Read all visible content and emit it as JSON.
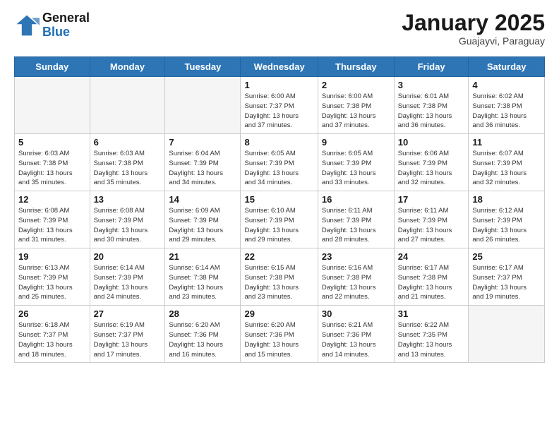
{
  "header": {
    "logo_line1": "General",
    "logo_line2": "Blue",
    "month": "January 2025",
    "location": "Guajayvi, Paraguay"
  },
  "days_of_week": [
    "Sunday",
    "Monday",
    "Tuesday",
    "Wednesday",
    "Thursday",
    "Friday",
    "Saturday"
  ],
  "weeks": [
    [
      {
        "day": "",
        "info": ""
      },
      {
        "day": "",
        "info": ""
      },
      {
        "day": "",
        "info": ""
      },
      {
        "day": "1",
        "info": "Sunrise: 6:00 AM\nSunset: 7:37 PM\nDaylight: 13 hours\nand 37 minutes."
      },
      {
        "day": "2",
        "info": "Sunrise: 6:00 AM\nSunset: 7:38 PM\nDaylight: 13 hours\nand 37 minutes."
      },
      {
        "day": "3",
        "info": "Sunrise: 6:01 AM\nSunset: 7:38 PM\nDaylight: 13 hours\nand 36 minutes."
      },
      {
        "day": "4",
        "info": "Sunrise: 6:02 AM\nSunset: 7:38 PM\nDaylight: 13 hours\nand 36 minutes."
      }
    ],
    [
      {
        "day": "5",
        "info": "Sunrise: 6:03 AM\nSunset: 7:38 PM\nDaylight: 13 hours\nand 35 minutes."
      },
      {
        "day": "6",
        "info": "Sunrise: 6:03 AM\nSunset: 7:38 PM\nDaylight: 13 hours\nand 35 minutes."
      },
      {
        "day": "7",
        "info": "Sunrise: 6:04 AM\nSunset: 7:39 PM\nDaylight: 13 hours\nand 34 minutes."
      },
      {
        "day": "8",
        "info": "Sunrise: 6:05 AM\nSunset: 7:39 PM\nDaylight: 13 hours\nand 34 minutes."
      },
      {
        "day": "9",
        "info": "Sunrise: 6:05 AM\nSunset: 7:39 PM\nDaylight: 13 hours\nand 33 minutes."
      },
      {
        "day": "10",
        "info": "Sunrise: 6:06 AM\nSunset: 7:39 PM\nDaylight: 13 hours\nand 32 minutes."
      },
      {
        "day": "11",
        "info": "Sunrise: 6:07 AM\nSunset: 7:39 PM\nDaylight: 13 hours\nand 32 minutes."
      }
    ],
    [
      {
        "day": "12",
        "info": "Sunrise: 6:08 AM\nSunset: 7:39 PM\nDaylight: 13 hours\nand 31 minutes."
      },
      {
        "day": "13",
        "info": "Sunrise: 6:08 AM\nSunset: 7:39 PM\nDaylight: 13 hours\nand 30 minutes."
      },
      {
        "day": "14",
        "info": "Sunrise: 6:09 AM\nSunset: 7:39 PM\nDaylight: 13 hours\nand 29 minutes."
      },
      {
        "day": "15",
        "info": "Sunrise: 6:10 AM\nSunset: 7:39 PM\nDaylight: 13 hours\nand 29 minutes."
      },
      {
        "day": "16",
        "info": "Sunrise: 6:11 AM\nSunset: 7:39 PM\nDaylight: 13 hours\nand 28 minutes."
      },
      {
        "day": "17",
        "info": "Sunrise: 6:11 AM\nSunset: 7:39 PM\nDaylight: 13 hours\nand 27 minutes."
      },
      {
        "day": "18",
        "info": "Sunrise: 6:12 AM\nSunset: 7:39 PM\nDaylight: 13 hours\nand 26 minutes."
      }
    ],
    [
      {
        "day": "19",
        "info": "Sunrise: 6:13 AM\nSunset: 7:39 PM\nDaylight: 13 hours\nand 25 minutes."
      },
      {
        "day": "20",
        "info": "Sunrise: 6:14 AM\nSunset: 7:39 PM\nDaylight: 13 hours\nand 24 minutes."
      },
      {
        "day": "21",
        "info": "Sunrise: 6:14 AM\nSunset: 7:38 PM\nDaylight: 13 hours\nand 23 minutes."
      },
      {
        "day": "22",
        "info": "Sunrise: 6:15 AM\nSunset: 7:38 PM\nDaylight: 13 hours\nand 23 minutes."
      },
      {
        "day": "23",
        "info": "Sunrise: 6:16 AM\nSunset: 7:38 PM\nDaylight: 13 hours\nand 22 minutes."
      },
      {
        "day": "24",
        "info": "Sunrise: 6:17 AM\nSunset: 7:38 PM\nDaylight: 13 hours\nand 21 minutes."
      },
      {
        "day": "25",
        "info": "Sunrise: 6:17 AM\nSunset: 7:37 PM\nDaylight: 13 hours\nand 19 minutes."
      }
    ],
    [
      {
        "day": "26",
        "info": "Sunrise: 6:18 AM\nSunset: 7:37 PM\nDaylight: 13 hours\nand 18 minutes."
      },
      {
        "day": "27",
        "info": "Sunrise: 6:19 AM\nSunset: 7:37 PM\nDaylight: 13 hours\nand 17 minutes."
      },
      {
        "day": "28",
        "info": "Sunrise: 6:20 AM\nSunset: 7:36 PM\nDaylight: 13 hours\nand 16 minutes."
      },
      {
        "day": "29",
        "info": "Sunrise: 6:20 AM\nSunset: 7:36 PM\nDaylight: 13 hours\nand 15 minutes."
      },
      {
        "day": "30",
        "info": "Sunrise: 6:21 AM\nSunset: 7:36 PM\nDaylight: 13 hours\nand 14 minutes."
      },
      {
        "day": "31",
        "info": "Sunrise: 6:22 AM\nSunset: 7:35 PM\nDaylight: 13 hours\nand 13 minutes."
      },
      {
        "day": "",
        "info": ""
      }
    ]
  ]
}
